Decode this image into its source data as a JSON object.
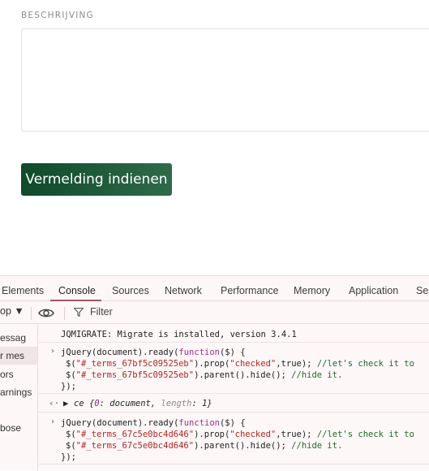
{
  "form": {
    "description_label": "BESCHRIJVING",
    "description_value": "",
    "submit_label": "Vermelding indienen",
    "accent": "#1d5a38"
  },
  "devtools": {
    "tabs": [
      {
        "label": "Elements",
        "active": false
      },
      {
        "label": "Console",
        "active": true
      },
      {
        "label": "Sources",
        "active": false
      },
      {
        "label": "Network",
        "active": false
      },
      {
        "label": "Performance",
        "active": false
      },
      {
        "label": "Memory",
        "active": false
      },
      {
        "label": "Application",
        "active": false
      },
      {
        "label": "Se",
        "active": false
      }
    ],
    "toolbar": {
      "context_label": "op ▼",
      "filter_label": "Filter"
    },
    "sidebar": [
      {
        "label": "essag",
        "selected": false
      },
      {
        "label": "r mes",
        "selected": true
      },
      {
        "label": "ors",
        "selected": false
      },
      {
        "label": "arnings",
        "selected": false
      },
      {
        "label": "",
        "selected": false
      },
      {
        "label": "bose",
        "selected": false
      }
    ],
    "console": {
      "msg1": "JQMIGRATE: Migrate is installed, version 3.4.1",
      "block1": {
        "l1_a": "jQuery(document).ready(",
        "l1_kw": "function",
        "l1_b": "($) {",
        "l2_a": "$(",
        "l2_s1": "\"#_terms_67bf5c09525eb\"",
        "l2_b": ").prop(",
        "l2_s2": "\"checked\"",
        "l2_c": ",true); ",
        "l2_cm": "//let's check it to",
        "l3_a": "$(",
        "l3_s1": "\"#_terms_67bf5c09525eb\"",
        "l3_b": ").parent().hide(); ",
        "l3_cm": "//hide it.",
        "l4": "});"
      },
      "result": {
        "name": "ce",
        "open": " {",
        "k1": "0",
        "v1": ": document, ",
        "k2": "length",
        "v2": ": 1}"
      },
      "block2": {
        "l1_a": "jQuery(document).ready(",
        "l1_kw": "function",
        "l1_b": "($) {",
        "l2_a": "$(",
        "l2_s1": "\"#_terms_67c5e0bc4d646\"",
        "l2_b": ").prop(",
        "l2_s2": "\"checked\"",
        "l2_c": ",true); ",
        "l2_cm": "//let's check it to",
        "l3_a": "$(",
        "l3_s1": "\"#_terms_67c5e0bc4d646\"",
        "l3_b": ").parent().hide(); ",
        "l3_cm": "//hide it.",
        "l4": "});"
      }
    }
  }
}
